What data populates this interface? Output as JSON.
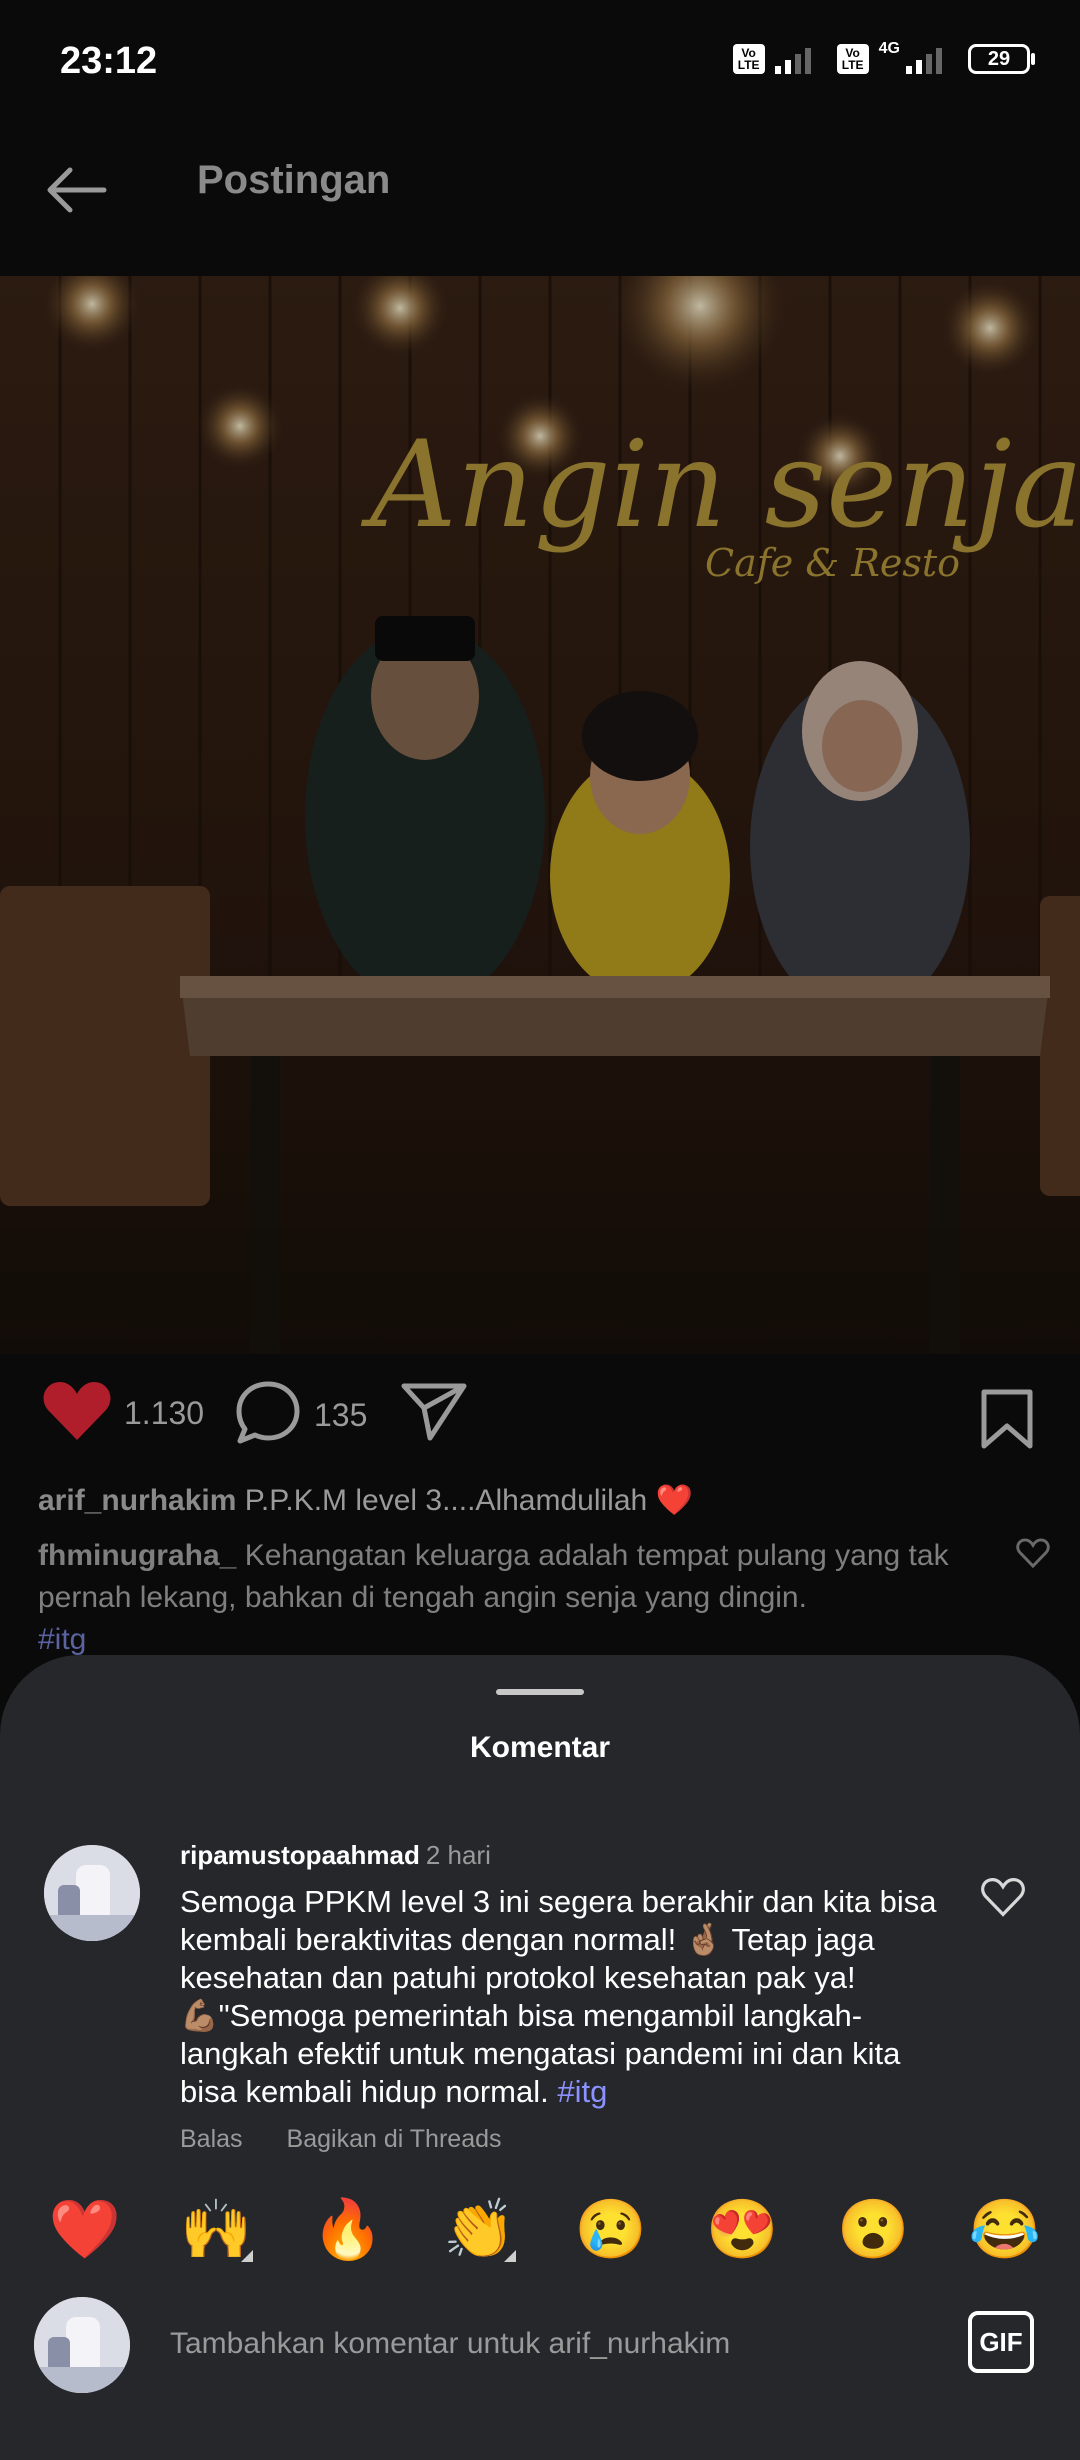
{
  "status_bar": {
    "time": "23:12",
    "volte_label": "Vo LTE",
    "network_type": "4G",
    "battery_level": "29"
  },
  "header": {
    "title": "Postingan"
  },
  "post": {
    "photo_sign_main": "Angin senja",
    "photo_sign_sub": "Cafe & Resto",
    "like_count": "1.130",
    "comment_count": "135",
    "caption_user": "arif_nurhakim",
    "caption_text": "P.P.K.M level 3....Alhamdulilah ❤️",
    "top_comment_user": "fhminugraha_",
    "top_comment_text": "Kehangatan keluarga adalah tempat pulang yang tak pernah lekang, bahkan di tengah angin senja yang dingin.",
    "top_comment_hashtag": "#itg"
  },
  "sheet": {
    "title": "Komentar",
    "comment": {
      "user": "ripamustopaahmad",
      "time": "2 hari",
      "text": "Semoga PPKM level 3 ini segera berakhir dan kita bisa kembali beraktivitas dengan normal! 🤞🏽 Tetap jaga kesehatan dan patuhi protokol kesehatan pak ya! 💪🏽\"Semoga pemerintah bisa mengambil langkah-langkah efektif untuk mengatasi pandemi ini dan kita bisa kembali hidup normal.",
      "hashtag": "#itg",
      "reply_label": "Balas",
      "share_label": "Bagikan di Threads"
    },
    "emojis": [
      "❤️",
      "🙌",
      "🔥",
      "👏",
      "😢",
      "😍",
      "😮",
      "😂"
    ],
    "input_placeholder": "Tambahkan komentar untuk arif_nurhakim",
    "gif_label": "GIF"
  },
  "colors": {
    "like_red": "#b01e2b",
    "sheet_bg": "#25272b",
    "hashtag": "#8b92ff"
  }
}
